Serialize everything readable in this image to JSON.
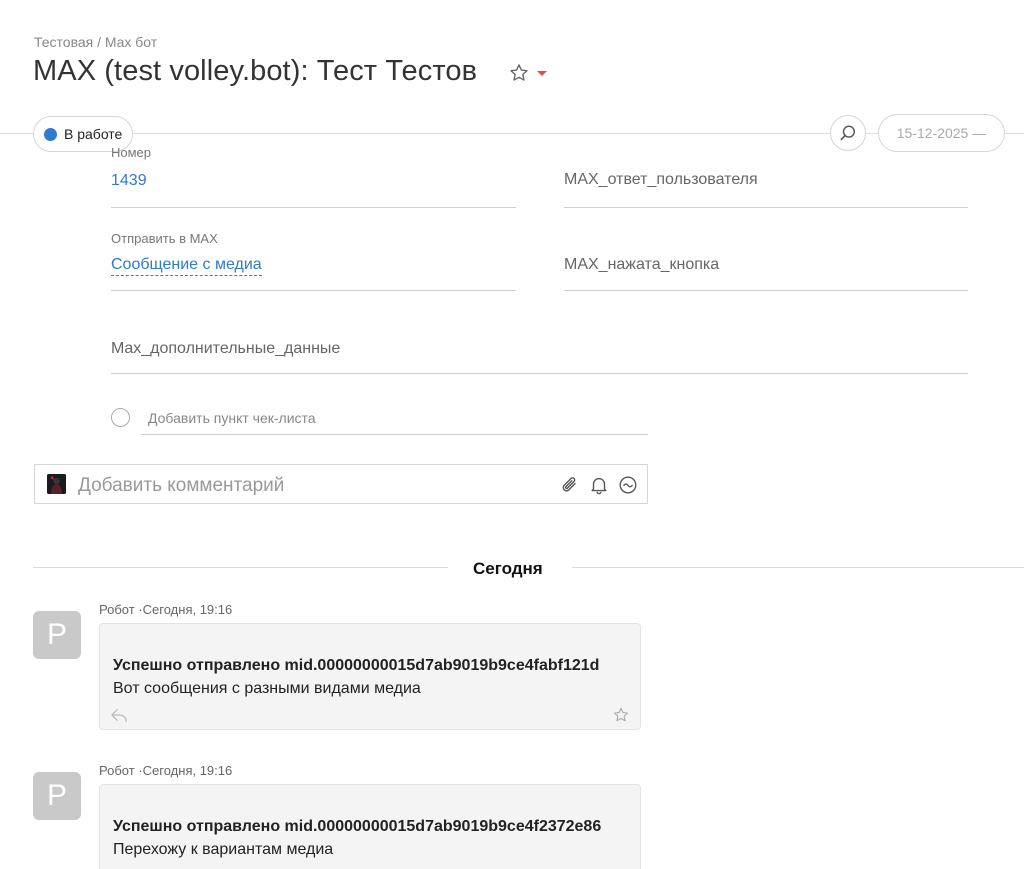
{
  "breadcrumb": {
    "parent": "Тестовая",
    "separator": "/",
    "current": "Max бот"
  },
  "title": "MAX (test volley.bot): Тест Тестов",
  "status": {
    "label": "В работе",
    "color": "#2f7bd0"
  },
  "date_filter": "15-12-2025 —",
  "fields": {
    "number": {
      "label": "Номер",
      "value": "1439"
    },
    "max_user_answer": {
      "placeholder": "MAX_ответ_пользователя"
    },
    "send_to_max": {
      "label": "Отправить в MAX",
      "value": "Сообщение с медиа"
    },
    "max_button_pressed": {
      "placeholder": "MAX_нажата_кнопка"
    },
    "max_extra_data": {
      "placeholder": "Max_дополнительные_данные"
    }
  },
  "checklist": {
    "placeholder": "Добавить пункт чек-листа"
  },
  "comment": {
    "placeholder": "Добавить комментарий",
    "icons": [
      "paperclip-icon",
      "bell-icon",
      "emoji-icon"
    ]
  },
  "day_separator": "Сегодня",
  "messages": [
    {
      "avatar_letter": "Р",
      "author": "Робот",
      "time": "Сегодня, 19:16",
      "title": "Успешно отправлено mid.00000000015d7ab9019b9ce4fabf121d",
      "text": "Вот сообщения с разными видами медиа"
    },
    {
      "avatar_letter": "Р",
      "author": "Робот",
      "time": "Сегодня, 19:16",
      "title": "Успешно отправлено mid.00000000015d7ab9019b9ce4f2372e86",
      "text": "Перехожу к вариантам медиа"
    }
  ],
  "colors": {
    "accent": "#2f7bd0",
    "caret": "#e05050"
  }
}
